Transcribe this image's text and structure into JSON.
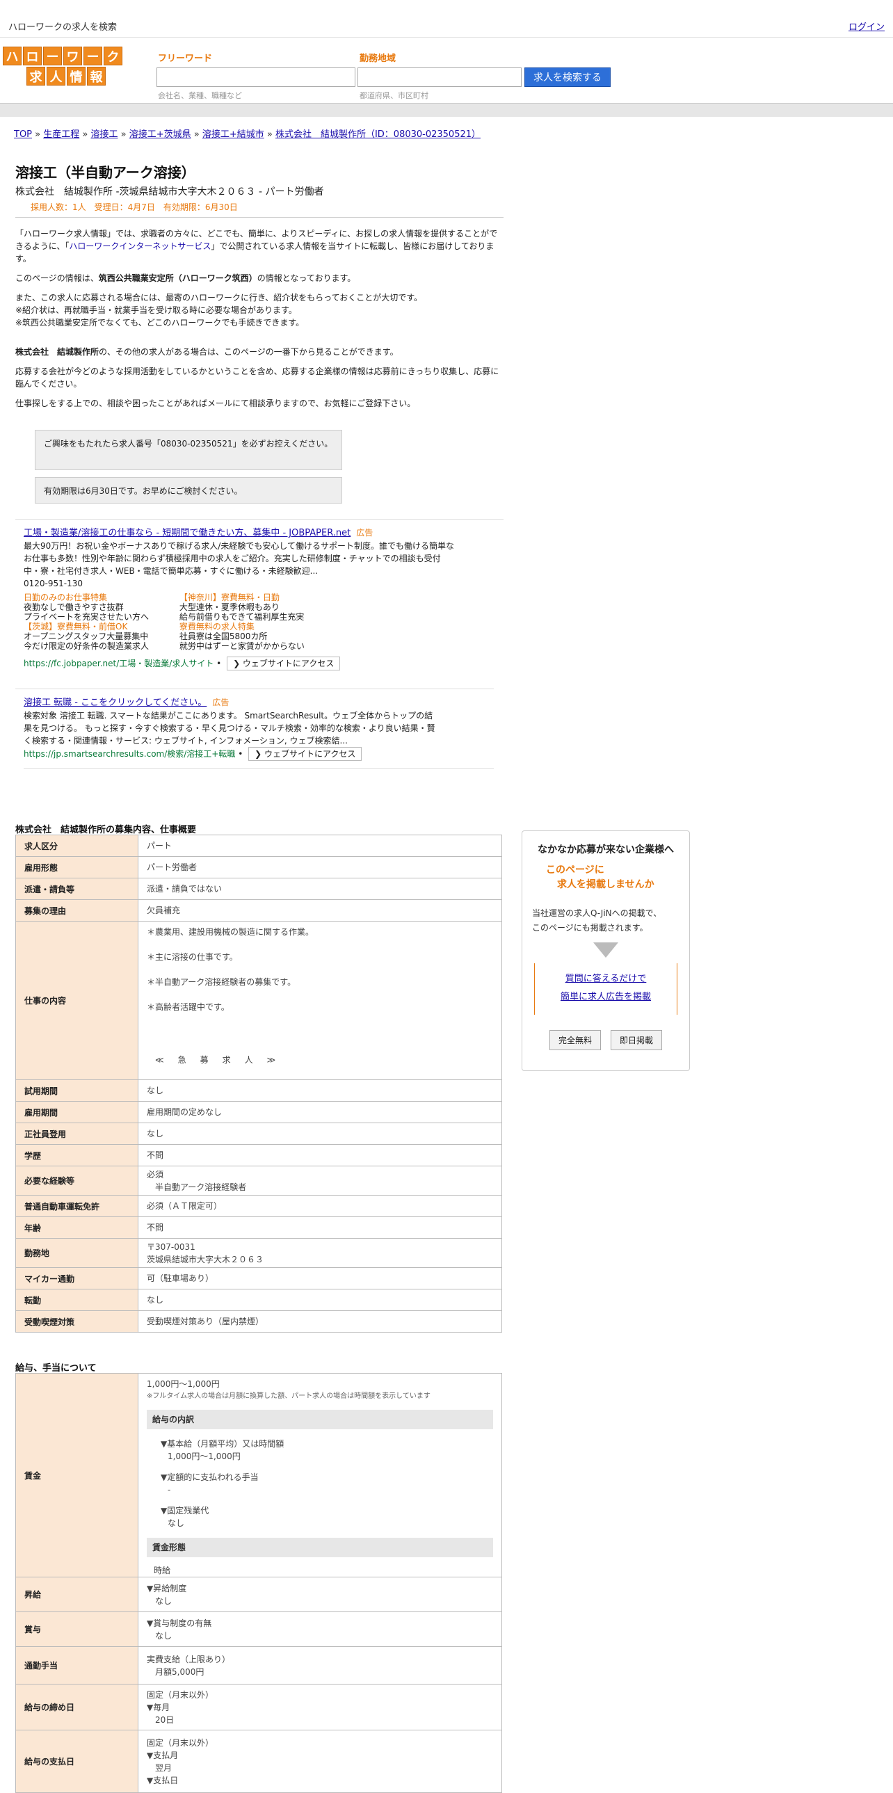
{
  "topbar": {
    "title": "ハローワークの求人を検索",
    "login": "ログイン"
  },
  "logo": {
    "row1": [
      "ハ",
      "ロ",
      "ー",
      "ワ",
      "ー",
      "ク"
    ],
    "row2": [
      "求",
      "人",
      "情",
      "報"
    ]
  },
  "search": {
    "freeword_label": "フリーワード",
    "freeword_hint": "会社名、業種、職種など",
    "area_label": "勤務地域",
    "area_hint": "都道府県、市区町村",
    "button": "求人を検索する"
  },
  "breadcrumb": [
    "TOP",
    "生産工程",
    "溶接工",
    "溶接工+茨城県",
    "溶接工+結城市",
    "株式会社　結城製作所（ID：08030-02350521）"
  ],
  "job": {
    "title": "溶接工（半自動アーク溶接）",
    "company_line": "株式会社　結城製作所 -茨城県結城市大字大木２０６３ - パート労働者",
    "meta": "採用人数：1人　受理日：4月7日　有効期限：6月30日"
  },
  "intro": {
    "p1a": "「ハローワーク求人情報」では、求職者の方々に、どこでも、簡単に、よりスピーディに、お探しの求人情報を提供することができるように、「",
    "p1link": "ハローワークインターネットサービス",
    "p1b": "」で公開されている求人情報を当サイトに転載し、皆様にお届けしております。",
    "p2a": "このページの情報は、",
    "p2b": "筑西公共職業安定所（ハローワーク筑西）",
    "p2c": "の情報となっております。",
    "p3": "また、この求人に応募される場合には、最寄のハローワークに行き、紹介状をもらっておくことが大切です。",
    "p3b": "※紹介状は、再就職手当・就業手当を受け取る時に必要な場合があります。",
    "p3c": "※筑西公共職業安定所でなくても、どこのハローワークでも手続きできます。",
    "p4a": "株式会社　結城製作所",
    "p4b": "の、その他の求人がある場合は、このページの一番下から見ることができます。",
    "p5": "応募する会社が今どのような採用活動をしているかということを含め、応募する企業様の情報は応募前にきっちり収集し、応募に臨んでください。",
    "p6": "仕事探しをする上での、相談や困ったことがあればメールにて相談承りますので、お気軽にご登録下さい。"
  },
  "notes": [
    "ご興味をもたれたら求人番号「08030-02350521」を必ずお控えください。",
    "有効期限は6月30日です。お早めにご検討ください。"
  ],
  "ad1": {
    "title": "工場・製造業/溶接工の仕事なら - 短期間で働きたい方、募集中 - JOBPAPER.net",
    "label": "広告",
    "desc": "最大90万円！お祝い金やボーナスありで稼げる求人/未経験でも安心して働けるサポート制度。誰でも働ける簡単なお仕事も多数！性別や年齢に関わらず積極採用中の求人をご紹介。充実した研修制度・チャットでの相談も受付中・寮・社宅付き求人・WEB・電話で簡単応募・すぐに働ける・未経験歓迎...",
    "phone": "0120-951-130",
    "subs": [
      {
        "h": "日勤のみのお仕事特集",
        "l1": "夜勤なしで働きやすさ抜群",
        "l2": "プライベートを充実させたい方へ"
      },
      {
        "h": "【神奈川】寮費無料・日勤",
        "l1": "大型連休・夏季休暇もあり",
        "l2": "給与前借りもできて福利厚生充実"
      },
      {
        "h": "【茨城】寮費無料・前借OK",
        "l1": "オープニングスタッフ大量募集中",
        "l2": "今だけ限定の好条件の製造業求人"
      },
      {
        "h": "寮費無料の求人特集",
        "l1": "社員寮は全国5800カ所",
        "l2": "就労中はずーと家賃がかからない"
      }
    ],
    "url": "https://fc.jobpaper.net/工場・製造業/求人サイト",
    "visit": "❯ ウェブサイトにアクセス"
  },
  "ad2": {
    "title": "溶接工 転職 - ここをクリックしてください。",
    "label": "広告",
    "desc": "検索対象 溶接工 転職. スマートな結果がここにあります。 SmartSearchResult。ウェブ全体からトップの結果を見つける。 もっと探す・今すぐ検索する・早く見つける・マルチ検索・効率的な検索・より良い結果・賢く検索する・関連情報・サービス: ウェブサイト, インフォメーション, ウェブ検索結...",
    "url": "https://jp.smartsearchresults.com/検索/溶接工+転職",
    "visit": "❯ ウェブサイトにアクセス"
  },
  "section1": "株式会社　結城製作所の募集内容、仕事概要",
  "table1": [
    {
      "k": "求人区分",
      "v": [
        "パート"
      ]
    },
    {
      "k": "雇用形態",
      "v": [
        "パート労働者"
      ]
    },
    {
      "k": "派遣・請負等",
      "v": [
        "派遣・請負ではない"
      ]
    },
    {
      "k": "募集の理由",
      "v": [
        "欠員補充"
      ]
    },
    {
      "k": "仕事の内容",
      "v": [
        "＊農業用、建設用機械の製造に関する作業。",
        "＊主に溶接の仕事です。",
        "＊半自動アーク溶接経験者の募集です。",
        "＊高齢者活躍中です。",
        "≪　急　募　求　人　≫"
      ]
    },
    {
      "k": "試用期間",
      "v": [
        "なし"
      ]
    },
    {
      "k": "雇用期間",
      "v": [
        "雇用期間の定めなし"
      ]
    },
    {
      "k": "正社員登用",
      "v": [
        "なし"
      ]
    },
    {
      "k": "学歴",
      "v": [
        "不問"
      ]
    },
    {
      "k": "必要な経験等",
      "v": [
        "必須",
        "　半自動アーク溶接経験者"
      ]
    },
    {
      "k": "普通自動車運転免許",
      "v": [
        "必須（ＡＴ限定可）"
      ]
    },
    {
      "k": "年齢",
      "v": [
        "不問"
      ]
    },
    {
      "k": "勤務地",
      "v": [
        "〒307-0031",
        "茨城県結城市大字大木２０６３"
      ]
    },
    {
      "k": "マイカー通勤",
      "v": [
        "可（駐車場あり）"
      ]
    },
    {
      "k": "転勤",
      "v": [
        "なし"
      ]
    },
    {
      "k": "受動喫煙対策",
      "v": [
        "受動喫煙対策あり（屋内禁煙）"
      ]
    }
  ],
  "section2": "給与、手当について",
  "wage": {
    "k": "賃金",
    "top": "1,000円〜1,000円",
    "note": "※フルタイム求人の場合は月額に換算した額、パート求人の場合は時間額を表示しています",
    "sub1": "給与の内訳",
    "items": [
      [
        "▼基本給（月額平均）又は時間額",
        "1,000円〜1,000円"
      ],
      [
        "▼定額的に支払われる手当",
        "-"
      ],
      [
        "▼固定残業代",
        "なし"
      ]
    ],
    "sub2": "賃金形態",
    "form": "時給"
  },
  "table2": [
    {
      "k": "昇給",
      "v": [
        "▼昇給制度",
        "　なし"
      ]
    },
    {
      "k": "賞与",
      "v": [
        "▼賞与制度の有無",
        "　なし"
      ]
    },
    {
      "k": "通勤手当",
      "v": [
        "実費支給（上限あり）",
        "　月額5,000円"
      ]
    },
    {
      "k": "給与の締め日",
      "v": [
        "固定（月末以外）",
        "▼毎月",
        "　20日"
      ]
    },
    {
      "k": "給与の支払日",
      "v": [
        "固定（月末以外）",
        "▼支払月",
        "　翌月",
        "▼支払日"
      ]
    }
  ],
  "sidebox": {
    "head": "なかなか応募が来ない企業様へ",
    "orange1": "このページに",
    "orange2": "求人を掲載しませんか",
    "p1": "当社運営の求人Q-JiNへの掲載で、",
    "p2": "このページにも掲載されます。",
    "link1": "質問に答えるだけで",
    "link2": "簡単に求人広告を掲載",
    "btn1": "完全無料",
    "btn2": "即日掲載"
  }
}
